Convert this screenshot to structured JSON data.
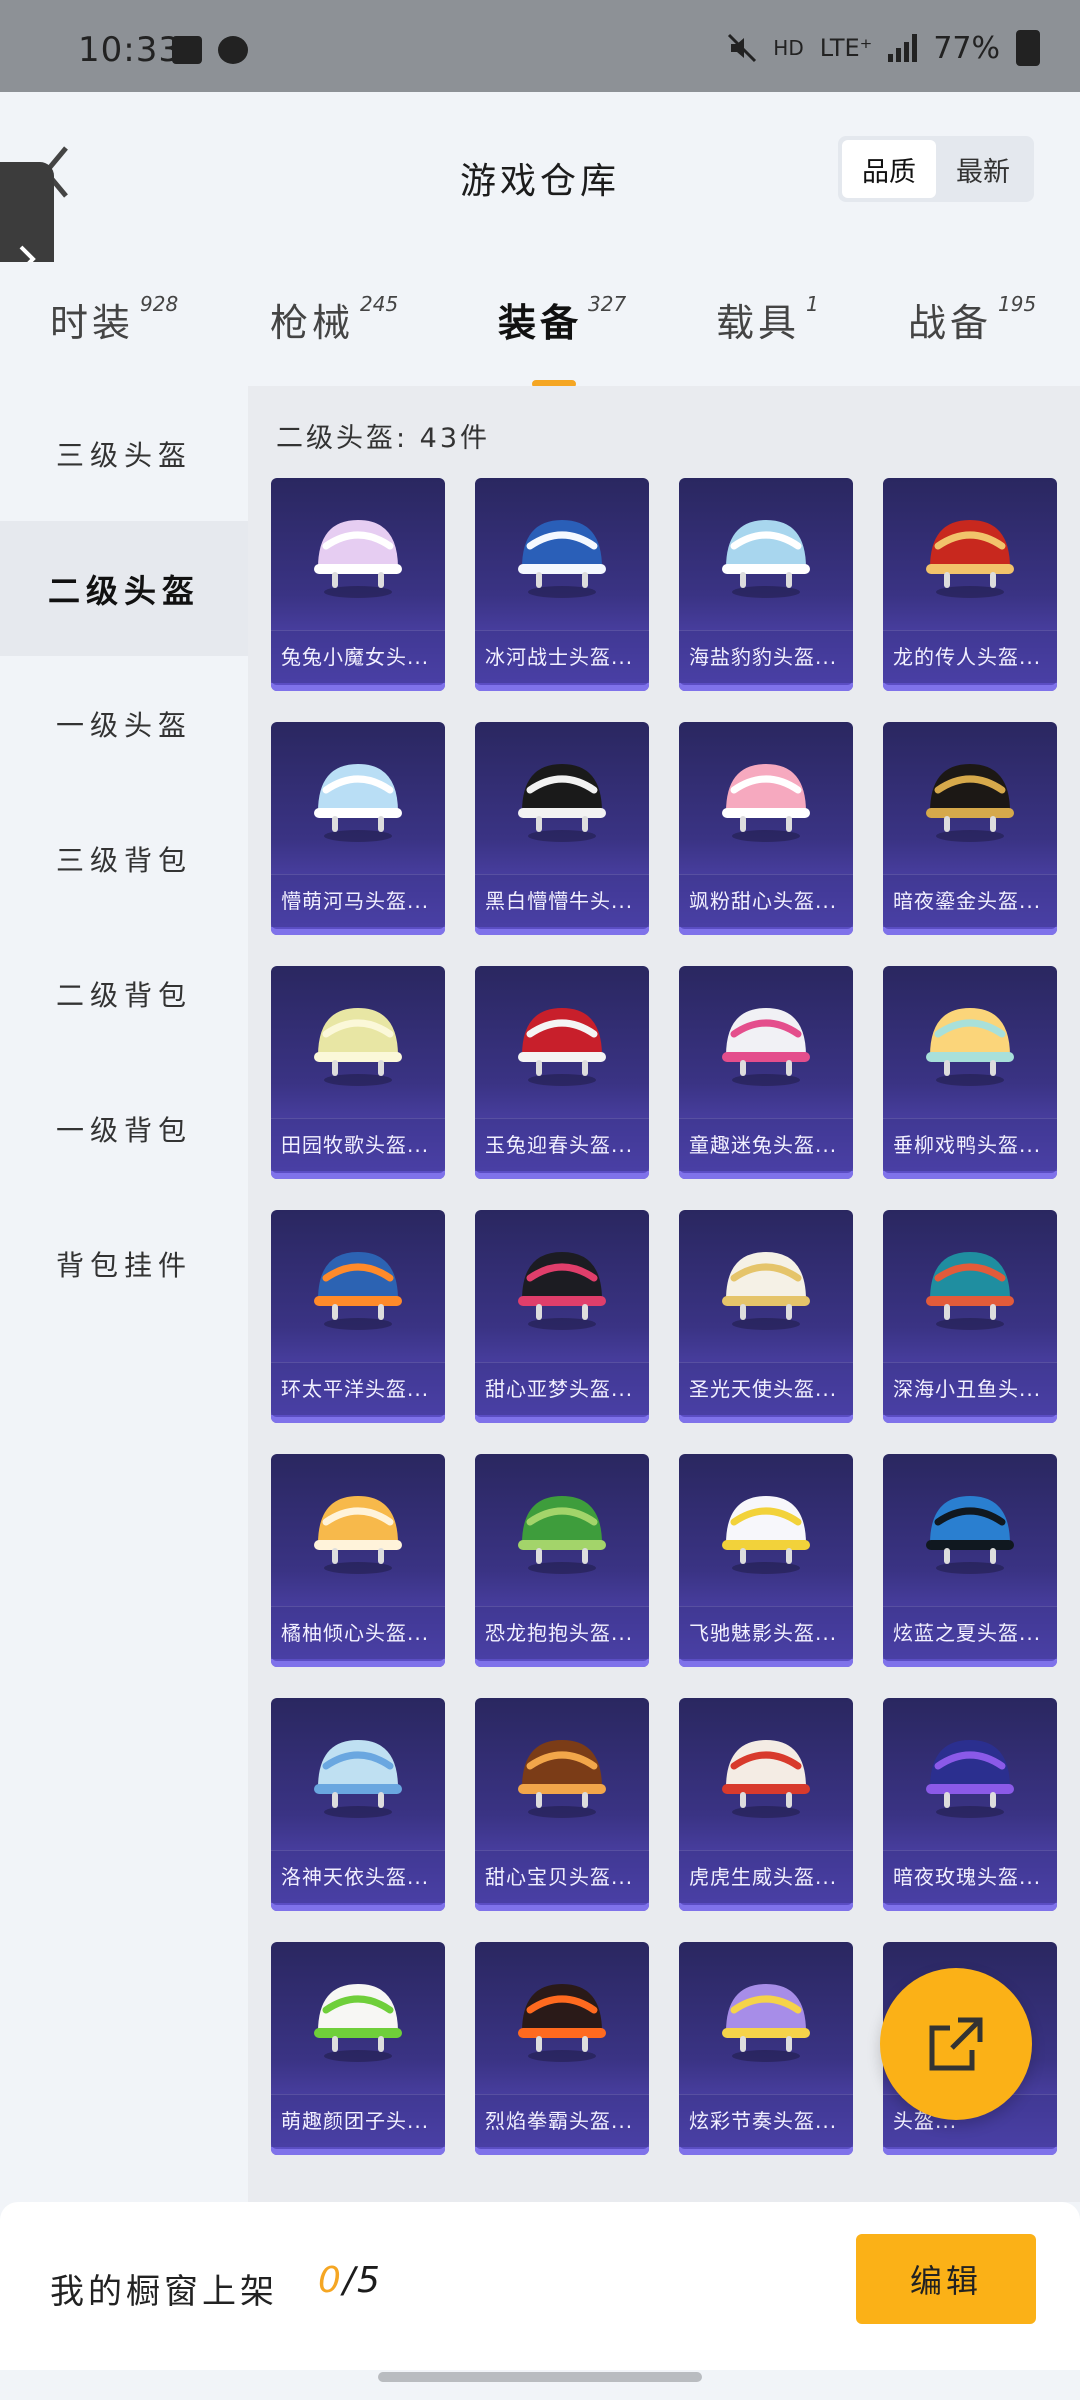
{
  "status_bar": {
    "time": "10:33",
    "network": "HD",
    "lte": "LTE⁺",
    "battery": "77%"
  },
  "header": {
    "title": "游戏仓库",
    "sort_options": [
      "品质",
      "最新"
    ],
    "sort_active": "品质"
  },
  "category_tabs": [
    {
      "label": "时装",
      "count": "928"
    },
    {
      "label": "枪械",
      "count": "245"
    },
    {
      "label": "装备",
      "count": "327",
      "active": true
    },
    {
      "label": "载具",
      "count": "1"
    },
    {
      "label": "战备",
      "count": "195"
    }
  ],
  "sidebar": [
    {
      "label": "三级头盔"
    },
    {
      "label": "二级头盔",
      "active": true
    },
    {
      "label": "一级头盔"
    },
    {
      "label": "三级背包"
    },
    {
      "label": "二级背包"
    },
    {
      "label": "一级背包"
    },
    {
      "label": "背包挂件"
    }
  ],
  "content": {
    "count_label": "二级头盔: 43件"
  },
  "items": [
    {
      "name": "兔兔小魔女头...",
      "color": "#e6cdf2",
      "accent": "#ffffff"
    },
    {
      "name": "冰河战士头盔...",
      "color": "#2a5fb8",
      "accent": "#f4f8ff"
    },
    {
      "name": "海盐豹豹头盔...",
      "color": "#a8d6ee",
      "accent": "#ffffff"
    },
    {
      "name": "龙的传人头盔...",
      "color": "#c8281e",
      "accent": "#f2c36b"
    },
    {
      "name": "懵萌河马头盔...",
      "color": "#b9def5",
      "accent": "#ffffff"
    },
    {
      "name": "黑白懵懵牛头...",
      "color": "#1a1a1a",
      "accent": "#f2f2f2"
    },
    {
      "name": "飒粉甜心头盔...",
      "color": "#f6a9bf",
      "accent": "#ffffff"
    },
    {
      "name": "暗夜鎏金头盔...",
      "color": "#1c1815",
      "accent": "#d6a94b"
    },
    {
      "name": "田园牧歌头盔...",
      "color": "#e8e6a4",
      "accent": "#fbf8d9"
    },
    {
      "name": "玉兔迎春头盔...",
      "color": "#c81f2b",
      "accent": "#f4f4f4"
    },
    {
      "name": "童趣迷兔头盔...",
      "color": "#f1f1f5",
      "accent": "#e44e8c"
    },
    {
      "name": "垂柳戏鸭头盔...",
      "color": "#fbd57a",
      "accent": "#a8e0da"
    },
    {
      "name": "环太平洋头盔...",
      "color": "#2c63b3",
      "accent": "#ff8a2a"
    },
    {
      "name": "甜心亚梦头盔...",
      "color": "#1c1c22",
      "accent": "#e03e6b"
    },
    {
      "name": "圣光天使头盔...",
      "color": "#f5f1e6",
      "accent": "#e5c46a"
    },
    {
      "name": "深海小丑鱼头...",
      "color": "#1f8ea0",
      "accent": "#e25b3a"
    },
    {
      "name": "橘柚倾心头盔...",
      "color": "#f7b94b",
      "accent": "#fff3da"
    },
    {
      "name": "恐龙抱抱头盔...",
      "color": "#3e9d3c",
      "accent": "#a3d46a"
    },
    {
      "name": "飞驰魅影头盔...",
      "color": "#f7f7fb",
      "accent": "#f2d23a"
    },
    {
      "name": "炫蓝之夏头盔...",
      "color": "#2a7fd0",
      "accent": "#101820"
    },
    {
      "name": "洛神天依头盔...",
      "color": "#bfe0f2",
      "accent": "#6aa7e0"
    },
    {
      "name": "甜心宝贝头盔...",
      "color": "#7b3c17",
      "accent": "#f2a64a"
    },
    {
      "name": "虎虎生威头盔...",
      "color": "#f4ece4",
      "accent": "#d83a2c"
    },
    {
      "name": "暗夜玫瑰头盔...",
      "color": "#2b2f8f",
      "accent": "#8b5ae8"
    },
    {
      "name": "萌趣颜团子头...",
      "color": "#f7f7f4",
      "accent": "#6fcf3a"
    },
    {
      "name": "烈焰拳霸头盔...",
      "color": "#2a1a18",
      "accent": "#ff6a1f"
    },
    {
      "name": "炫彩节奏头盔...",
      "color": "#a78de8",
      "accent": "#f5d34a"
    },
    {
      "name": "头盔...",
      "color": "#7a5ad8",
      "accent": "#f2c230"
    }
  ],
  "bottom_bar": {
    "label": "我的橱窗上架",
    "current": "0",
    "total": "/5",
    "edit_label": "编辑"
  },
  "colors": {
    "accent": "#fbb117",
    "card_top": "#2a2760",
    "card_bottom": "#5d4fc8"
  }
}
